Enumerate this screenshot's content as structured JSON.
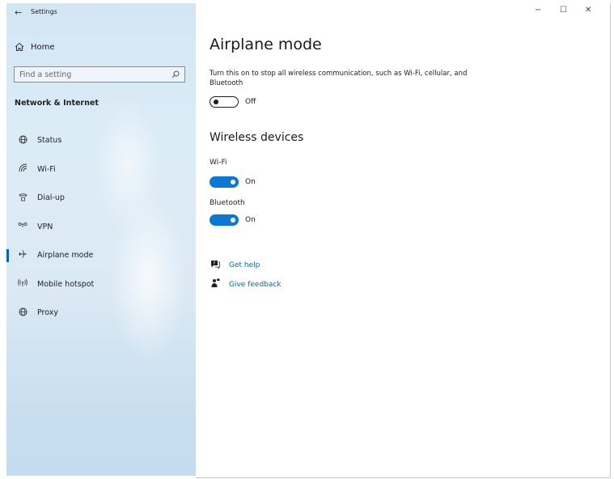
{
  "window": {
    "title": "Settings",
    "back_glyph": "←",
    "minimize_glyph": "−",
    "maximize_glyph": "☐",
    "close_glyph": "✕"
  },
  "sidebar": {
    "home_label": "Home",
    "search_placeholder": "Find a setting",
    "section_title": "Network & Internet",
    "items": [
      {
        "label": "Status",
        "icon": "globe-icon"
      },
      {
        "label": "Wi-Fi",
        "icon": "wifi-icon"
      },
      {
        "label": "Dial-up",
        "icon": "phone-icon"
      },
      {
        "label": "VPN",
        "icon": "vpn-icon"
      },
      {
        "label": "Airplane mode",
        "icon": "airplane-icon",
        "active": true
      },
      {
        "label": "Mobile hotspot",
        "icon": "hotspot-icon"
      },
      {
        "label": "Proxy",
        "icon": "globe-icon"
      }
    ]
  },
  "main": {
    "title": "Airplane mode",
    "description": "Turn this on to stop all wireless communication, such as Wi-Fi, cellular, and Bluetooth",
    "airplane_toggle": {
      "state": "Off"
    },
    "wireless_title": "Wireless devices",
    "wifi": {
      "label": "Wi-Fi",
      "state": "On"
    },
    "bluetooth": {
      "label": "Bluetooth",
      "state": "On"
    },
    "get_help": "Get help",
    "give_feedback": "Give feedback"
  },
  "colors": {
    "accent": "#0a78d4",
    "link": "#0067c0"
  }
}
